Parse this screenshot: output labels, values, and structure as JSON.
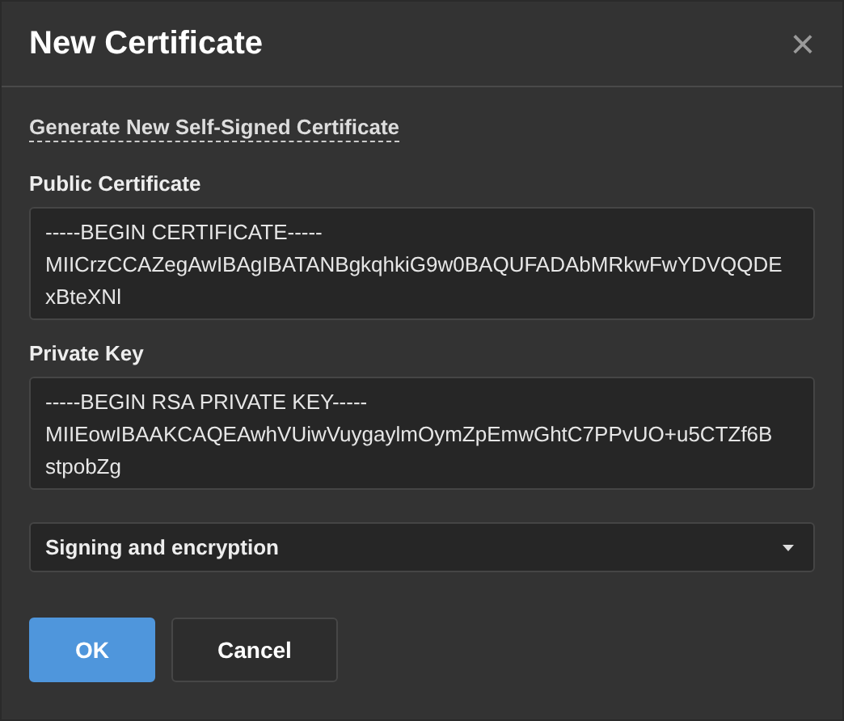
{
  "dialog": {
    "title": "New Certificate",
    "close": "×"
  },
  "generate_link": "Generate New Self-Signed Certificate",
  "fields": [
    {
      "label": "Public Certificate",
      "value": "-----BEGIN CERTIFICATE-----\nMIICrzCCAZegAwIBAgIBATANBgkqhkiG9w0BAQUFADAbMRkwFwYDVQQDE\nxBteXNl"
    },
    {
      "label": "Private Key",
      "value": "-----BEGIN RSA PRIVATE KEY-----\nMIIEowIBAAKCAQEAwhVUiwVuygaylmOymZpEmwGhtC7PPvUO+u5CTZf6B\nstpobZg"
    }
  ],
  "select": {
    "value": "Signing and encryption"
  },
  "buttons": [
    {
      "label": "OK",
      "kind": "primary"
    },
    {
      "label": "Cancel",
      "kind": "secondary"
    }
  ]
}
